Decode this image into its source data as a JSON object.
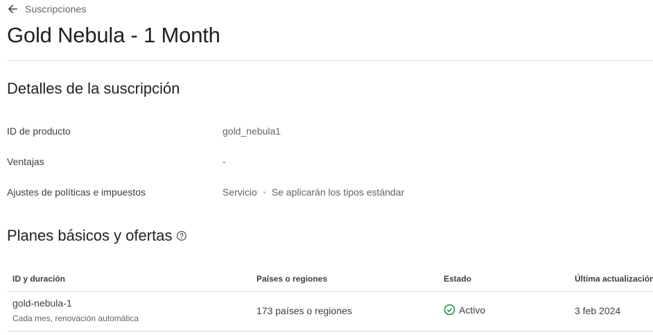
{
  "back_link": {
    "label": "Suscripciones",
    "icon": "arrow-left-icon"
  },
  "page_title": "Gold Nebula - 1 Month",
  "details": {
    "title": "Detalles de la suscripción",
    "rows": [
      {
        "label": "ID de producto",
        "value": "gold_nebula1"
      },
      {
        "label": "Ventajas",
        "value": "-"
      },
      {
        "label": "Ajustes de políticas e impuestos",
        "value_a": "Servicio",
        "value_b": "Se aplicarán los tipos estándar"
      }
    ]
  },
  "plans": {
    "title": "Planes básicos y ofertas",
    "help_icon": "help-circle-icon",
    "columns": [
      "ID y duración",
      "Países o regiones",
      "Estado",
      "Última actualización"
    ],
    "rows": [
      {
        "id": "gold-nebula-1",
        "duration": "Cada mes, renovación automática",
        "regions": "173 países o regiones",
        "status": "Activo",
        "status_icon": "check-circle-icon",
        "updated": "3 feb 2024"
      }
    ]
  },
  "colors": {
    "status_active": "#1e8e3e",
    "divider": "#dadce0",
    "text_primary": "#202124",
    "text_secondary": "#5f6368"
  }
}
